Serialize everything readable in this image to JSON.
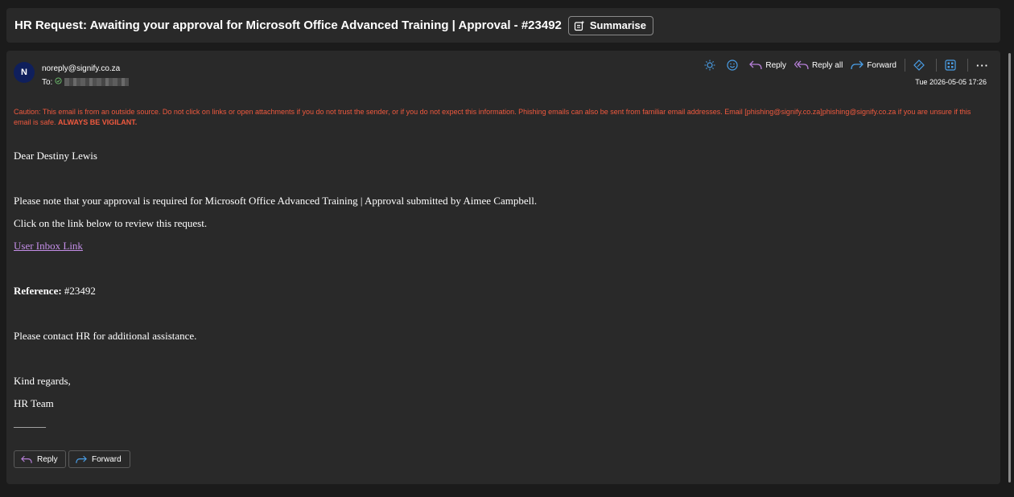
{
  "subject": {
    "title": "HR Request: Awaiting your approval for Microsoft Office Advanced Training | Approval - #23492",
    "summarise_label": "Summarise"
  },
  "header": {
    "avatar_initial": "N",
    "sender": "noreply@signify.co.za",
    "to_label": "To:",
    "date": "Tue 2026-05-05 17:26",
    "actions": {
      "reply": "Reply",
      "reply_all": "Reply all",
      "forward": "Forward",
      "more": "···"
    }
  },
  "caution": {
    "text": "Caution: This email is from an outside source. Do not click on links or open attachments if you do not trust the sender, or if you do not expect this information. Phishing emails can also be sent from familiar email addresses. Email [phishing@signify.co.za]phishing@signify.co.za if you are unsure if this email is safe.",
    "emphasis": "ALWAYS BE VIGILANT."
  },
  "body": {
    "greeting": "Dear Destiny Lewis",
    "para1": "Please note that your approval is required for Microsoft Office Advanced Training | Approval submitted by Aimee Campbell.",
    "para2": "Click on the link below to review this request.",
    "link": "User Inbox Link",
    "reference_label": "Reference:",
    "reference_value": " #23492",
    "contact": "Please contact HR for additional assistance.",
    "signoff": "Kind regards,",
    "signature": "HR Team",
    "rule": "________"
  },
  "footer": {
    "reply": "Reply",
    "forward": "Forward"
  },
  "colors": {
    "background": "#1b1b1b",
    "panel": "#292929",
    "caution": "#f0593e",
    "link": "#c48ee8",
    "accent_blue": "#4a9fe8",
    "reply_purple": "#b57fd6"
  }
}
